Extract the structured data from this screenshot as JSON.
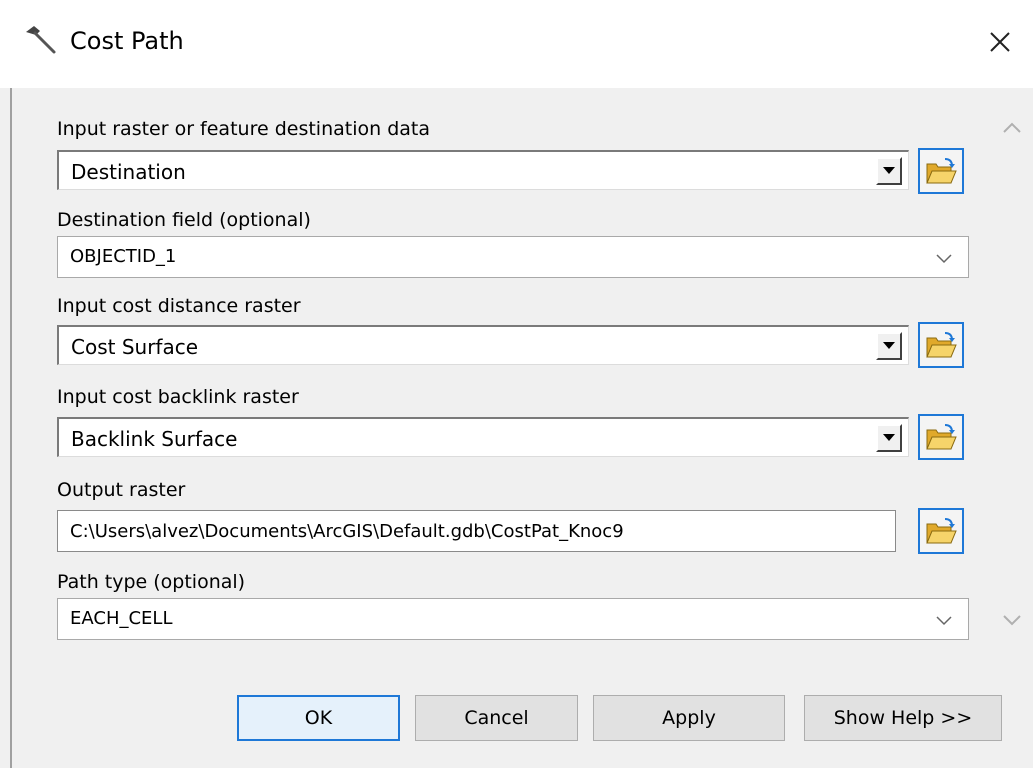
{
  "window": {
    "title": "Cost Path",
    "icon": "hammer-icon",
    "close_icon": "close-icon"
  },
  "fields": {
    "input_destination": {
      "label": "Input raster or feature destination data",
      "value": "Destination"
    },
    "destination_field": {
      "label": "Destination field (optional)",
      "value": "OBJECTID_1"
    },
    "cost_distance": {
      "label": "Input cost distance raster",
      "value": "Cost Surface"
    },
    "cost_backlink": {
      "label": "Input cost backlink raster",
      "value": "Backlink Surface"
    },
    "output_raster": {
      "label": "Output raster",
      "value": "C:\\Users\\alvez\\Documents\\ArcGIS\\Default.gdb\\CostPat_Knoc9"
    },
    "path_type": {
      "label": "Path type (optional)",
      "value": "EACH_CELL"
    }
  },
  "buttons": {
    "ok": "OK",
    "cancel": "Cancel",
    "apply": "Apply",
    "help": "Show Help >>"
  },
  "colors": {
    "accent": "#1e78d7",
    "folder": "#f2c744"
  }
}
